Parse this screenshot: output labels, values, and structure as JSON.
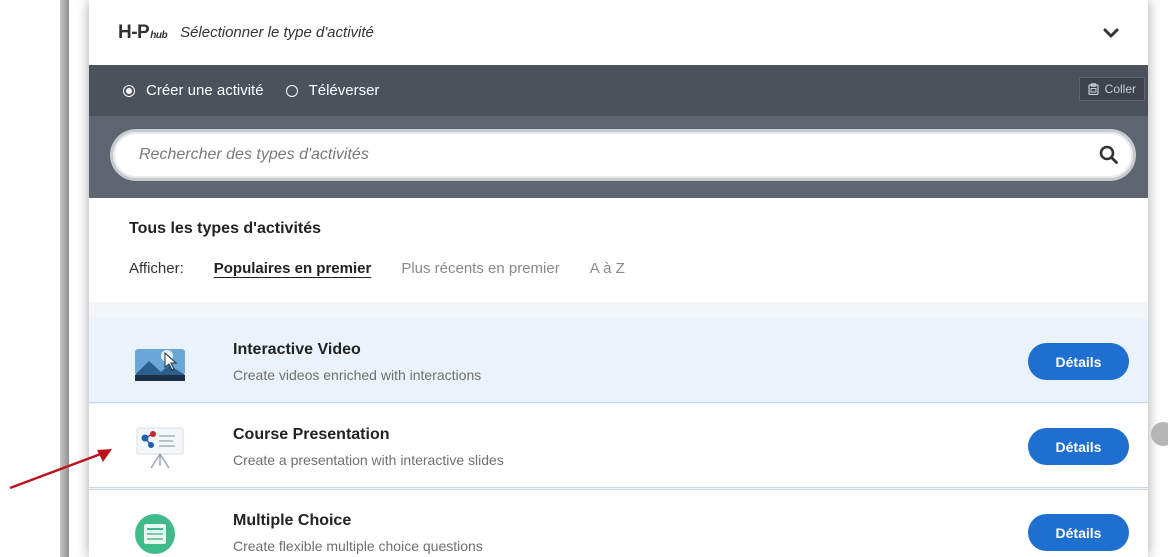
{
  "hub": {
    "logo_text": "H-P",
    "logo_sub": "hub",
    "title": "Sélectionner le type d'activité"
  },
  "mode": {
    "create_label": "Créer une activité",
    "upload_label": "Téléverser",
    "selected": "create",
    "paste_label": "Coller"
  },
  "search": {
    "placeholder": "Rechercher des types d'activités"
  },
  "filter": {
    "title": "Tous les types d'activités",
    "show_label": "Afficher:",
    "options": [
      "Populaires en premier",
      "Plus récents en premier",
      "A à Z"
    ],
    "active_index": 0
  },
  "items": [
    {
      "title": "Interactive Video",
      "description": "Create videos enriched with interactions",
      "button": "Détails",
      "icon": "interactive-video-icon"
    },
    {
      "title": "Course Presentation",
      "description": "Create a presentation with interactive slides",
      "button": "Détails",
      "icon": "course-presentation-icon"
    },
    {
      "title": "Multiple Choice",
      "description": "Create flexible multiple choice questions",
      "button": "Détails",
      "icon": "multiple-choice-icon"
    }
  ],
  "colors": {
    "mode_bar": "#4c525c",
    "search_bar": "#5e6571",
    "details_button": "#1e6fd0",
    "annotation_arrow": "#c0121c"
  }
}
